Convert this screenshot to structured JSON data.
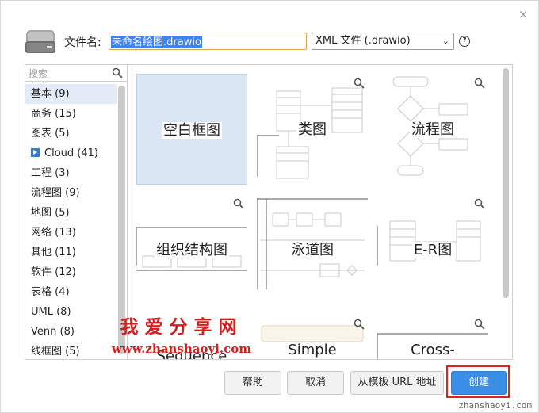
{
  "dialog": {
    "filename_label": "文件名:",
    "filename_value": "未命名绘图.drawio",
    "format_value": "XML 文件 (.drawio)",
    "help_glyph": "?",
    "close_glyph": "×"
  },
  "sidebar": {
    "search_placeholder": "搜索",
    "categories": [
      {
        "label": "基本 (9)"
      },
      {
        "label": "商务 (15)"
      },
      {
        "label": "图表 (5)"
      },
      {
        "label": "Cloud (41)"
      },
      {
        "label": "工程 (3)"
      },
      {
        "label": "流程图 (9)"
      },
      {
        "label": "地图 (5)"
      },
      {
        "label": "网络 (13)"
      },
      {
        "label": "其他 (11)"
      },
      {
        "label": "软件 (12)"
      },
      {
        "label": "表格 (4)"
      },
      {
        "label": "UML (8)"
      },
      {
        "label": "Venn (8)"
      },
      {
        "label": "线框图 (5)"
      }
    ]
  },
  "templates": [
    {
      "label": "空白框图"
    },
    {
      "label": "类图"
    },
    {
      "label": "流程图"
    },
    {
      "label": "组织结构图"
    },
    {
      "label": "泳道图"
    },
    {
      "label": "E-R图"
    },
    {
      "label": "Sequence"
    },
    {
      "label": "Simple"
    },
    {
      "label": "Cross-"
    }
  ],
  "watermark": {
    "cn": "我爱分享网",
    "url": "www.zhanshaoyi.com"
  },
  "buttons": {
    "help": "帮助",
    "cancel": "取消",
    "from_url": "从模板 URL 地址",
    "create": "创建"
  },
  "footer_url": "zhanshaoyi.com",
  "colors": {
    "primary": "#3a8ee6",
    "selected_tile": "#dbe6f4",
    "highlight": "#e3211f",
    "watermark": "#d21f1f"
  }
}
